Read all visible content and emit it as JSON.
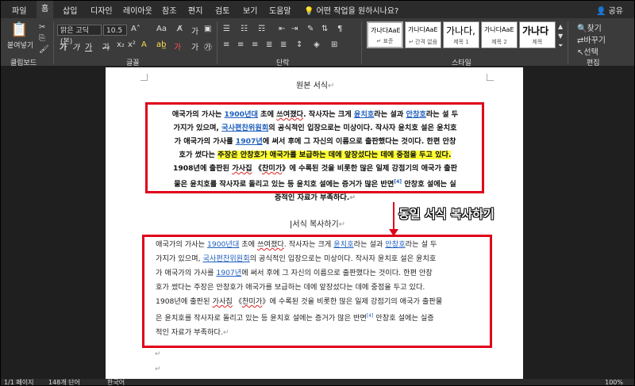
{
  "menu": {
    "tabs": [
      "파일",
      "홈",
      "삽입",
      "디자인",
      "레이아웃",
      "참조",
      "편지",
      "검토",
      "보기",
      "도움말"
    ],
    "active_tab": "홈",
    "tell_me": "어떤 작업을 원하시나요?",
    "share": "공유"
  },
  "ribbon": {
    "clipboard": {
      "paste": "붙여넣기",
      "label": "클립보드"
    },
    "font": {
      "name": "맑은 고딕(본)",
      "size": "10.5",
      "label": "글꼴",
      "bold": "가",
      "italic": "가",
      "underline": "가"
    },
    "paragraph": {
      "label": "단락"
    },
    "styles": {
      "label": "스타일",
      "items": [
        {
          "sample": "가나다AaE",
          "name": "↵ 표준"
        },
        {
          "sample": "가나다AaE",
          "name": "↵ 간격 없음"
        },
        {
          "sample": "가나다,",
          "name": "제목 1"
        },
        {
          "sample": "가나다AaE",
          "name": "제목 2"
        },
        {
          "sample": "가나다",
          "name": "제목"
        }
      ]
    },
    "editing": {
      "find": "찾기",
      "replace": "바꾸기",
      "select": "선택",
      "label": "편집"
    }
  },
  "document": {
    "heading_original": "원본 서식",
    "heading_copy": "서식 복사하기",
    "callout": "동일 서식 복사하기",
    "para1_lines": [
      [
        "애국가의 가사는 ",
        {
          "link": "1900년대"
        },
        " 초에 ",
        {
          "u": "쓰여졌다"
        },
        ". 작사자는 크게 ",
        {
          "link": "윤치호"
        },
        "라는 설과 ",
        {
          "link": "안창호"
        },
        "라는 설 두"
      ],
      [
        "가지가 있으며, ",
        {
          "link": "국사편찬위원회"
        },
        "의 공식적인 입장으로는 미상이다. 작사자 윤치호 설은 윤치호"
      ],
      [
        "가 애국가의 가사를 ",
        {
          "link": "1907년"
        },
        "에 써서 후에 그 자신의 이름으로 출판했다는 것이다. 한편 안창"
      ],
      [
        "호가 썼다는 ",
        {
          "hl": "주장은 안창호가 애국가를 보급하는 데에 앞장섰다는 데에 중점을 두고 있다."
        }
      ],
      [
        "1908년에 출판된 ",
        {
          "u": "가사집"
        },
        " 《",
        {
          "u": "찬미가"
        },
        "》에 수록된 것을 비롯한 많은 일제 강점기의 애국가 출판"
      ],
      [
        "물은 윤치호를 작사자로 돌리고 있는 등 윤치호 설에는 증거가 많은 반면",
        {
          "sup": "[4]"
        },
        " 안창호 설에는 실"
      ],
      [
        "증적인 자료가 부족하다."
      ]
    ],
    "para2_lines": [
      [
        "애국가의 가사는 ",
        {
          "link": "1900년대"
        },
        " 초에 ",
        {
          "u": "쓰여졌다"
        },
        ". 작사자는 크게 ",
        {
          "link": "윤치호"
        },
        "라는 설과 ",
        {
          "link": "안창호"
        },
        "라는 설 두"
      ],
      [
        "가지가 있으며, ",
        {
          "link": "국사편찬위원회"
        },
        "의 공식적인 입장으로는 미상이다. 작사자 윤치호 설은 윤치호"
      ],
      [
        "가 애국가의 가사를 ",
        {
          "link": "1907년"
        },
        "에 써서 후에 그 자신의 이름으로 출판했다는 것이다. 한편 안창"
      ],
      [
        "호가 썼다는 주장은 안창호가 애국가를 보급하는 데에 앞장섰다는 데에 중점을 두고 있다."
      ],
      [
        "1908년에 출판된 ",
        {
          "u": "가사집"
        },
        " 《",
        {
          "u": "찬미가"
        },
        "》에 수록된 것을 비롯한 많은 일제 강점기의 애국가 출판물"
      ],
      [
        "은 윤치호를 작사자로 돌리고 있는 등 윤치호 설에는 증거가 많은 반면",
        {
          "sup": "[4]"
        },
        " 안창호 설에는 실증"
      ],
      [
        "적인 자료가 부족하다."
      ]
    ]
  },
  "status": {
    "page": "1/1 페이지",
    "words": "148개 단어",
    "lang": "한국어",
    "zoom": "100%"
  },
  "colors": {
    "highlight": "#ffff33",
    "box": "#e0001a",
    "link": "#1f5fbf"
  }
}
